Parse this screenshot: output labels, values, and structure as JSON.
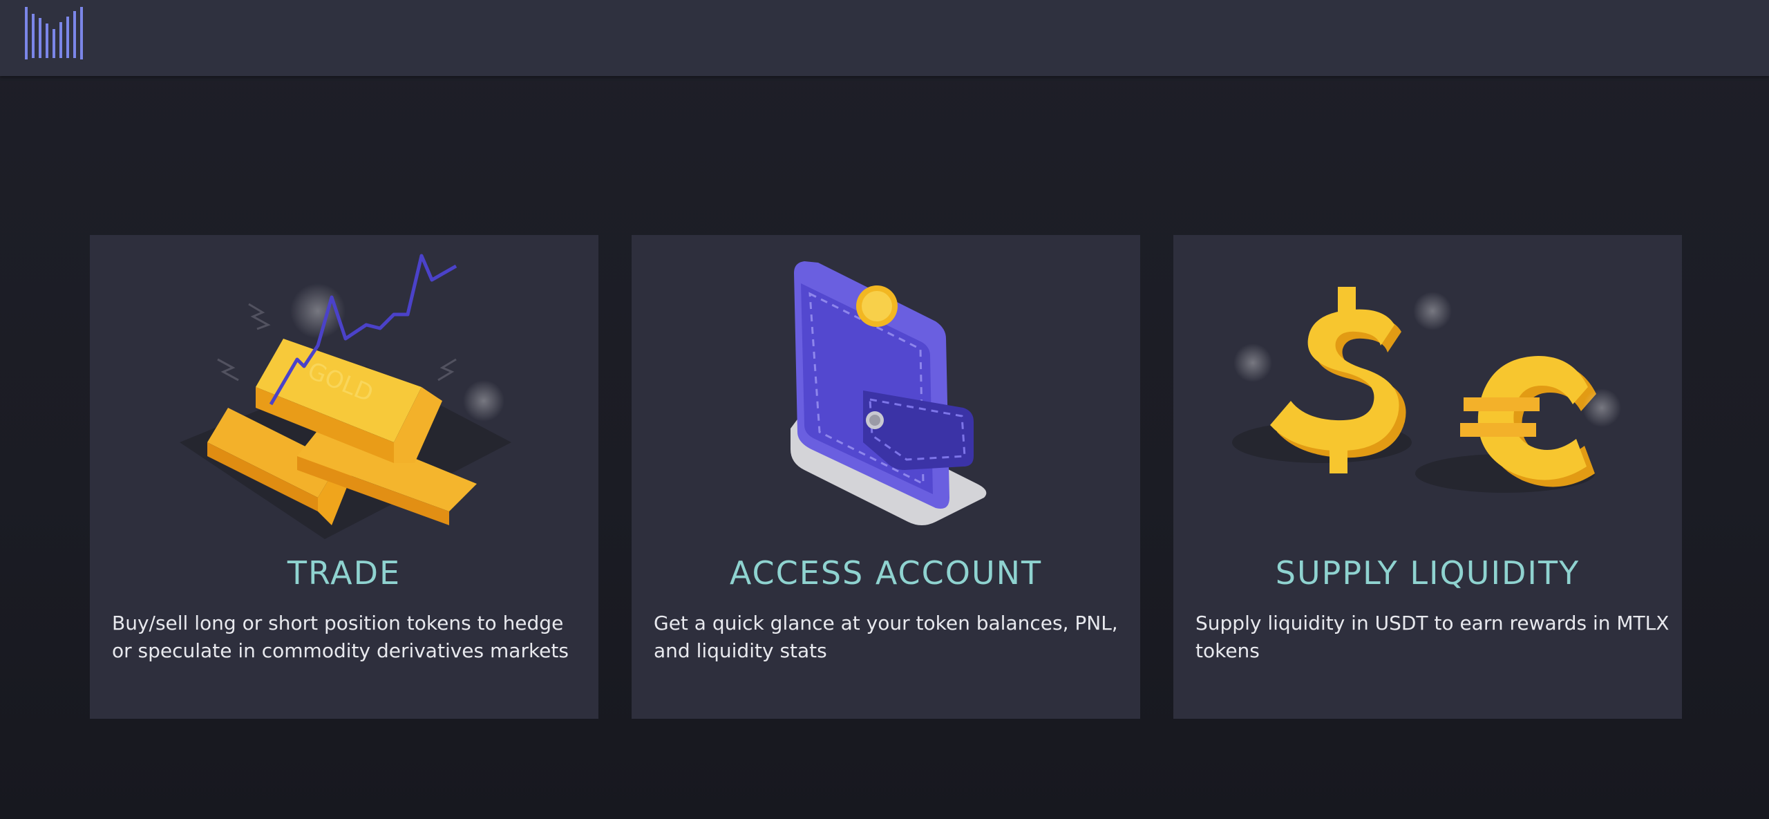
{
  "header": {
    "logo_icon": "bar-chart-logo-icon",
    "accent": "#7b86e8",
    "background": "#2f313f"
  },
  "cards": [
    {
      "title": "TRADE",
      "description": "Buy/sell long or short position tokens to hedge or speculate in commodity derivatives markets",
      "icon": "gold-bars-chart-icon"
    },
    {
      "title": "ACCESS ACCOUNT",
      "description": "Get a quick glance at your token balances, PNL, and liquidity stats",
      "icon": "wallet-icon"
    },
    {
      "title": "SUPPLY LIQUIDITY",
      "description": "Supply liquidity in USDT to earn rewards in MTLX tokens",
      "icon": "dollar-euro-icon"
    }
  ],
  "colors": {
    "title": "#8fd3d0",
    "text": "#e8e9ee",
    "card": "#2e2f3d",
    "page": "#1c1d25"
  }
}
